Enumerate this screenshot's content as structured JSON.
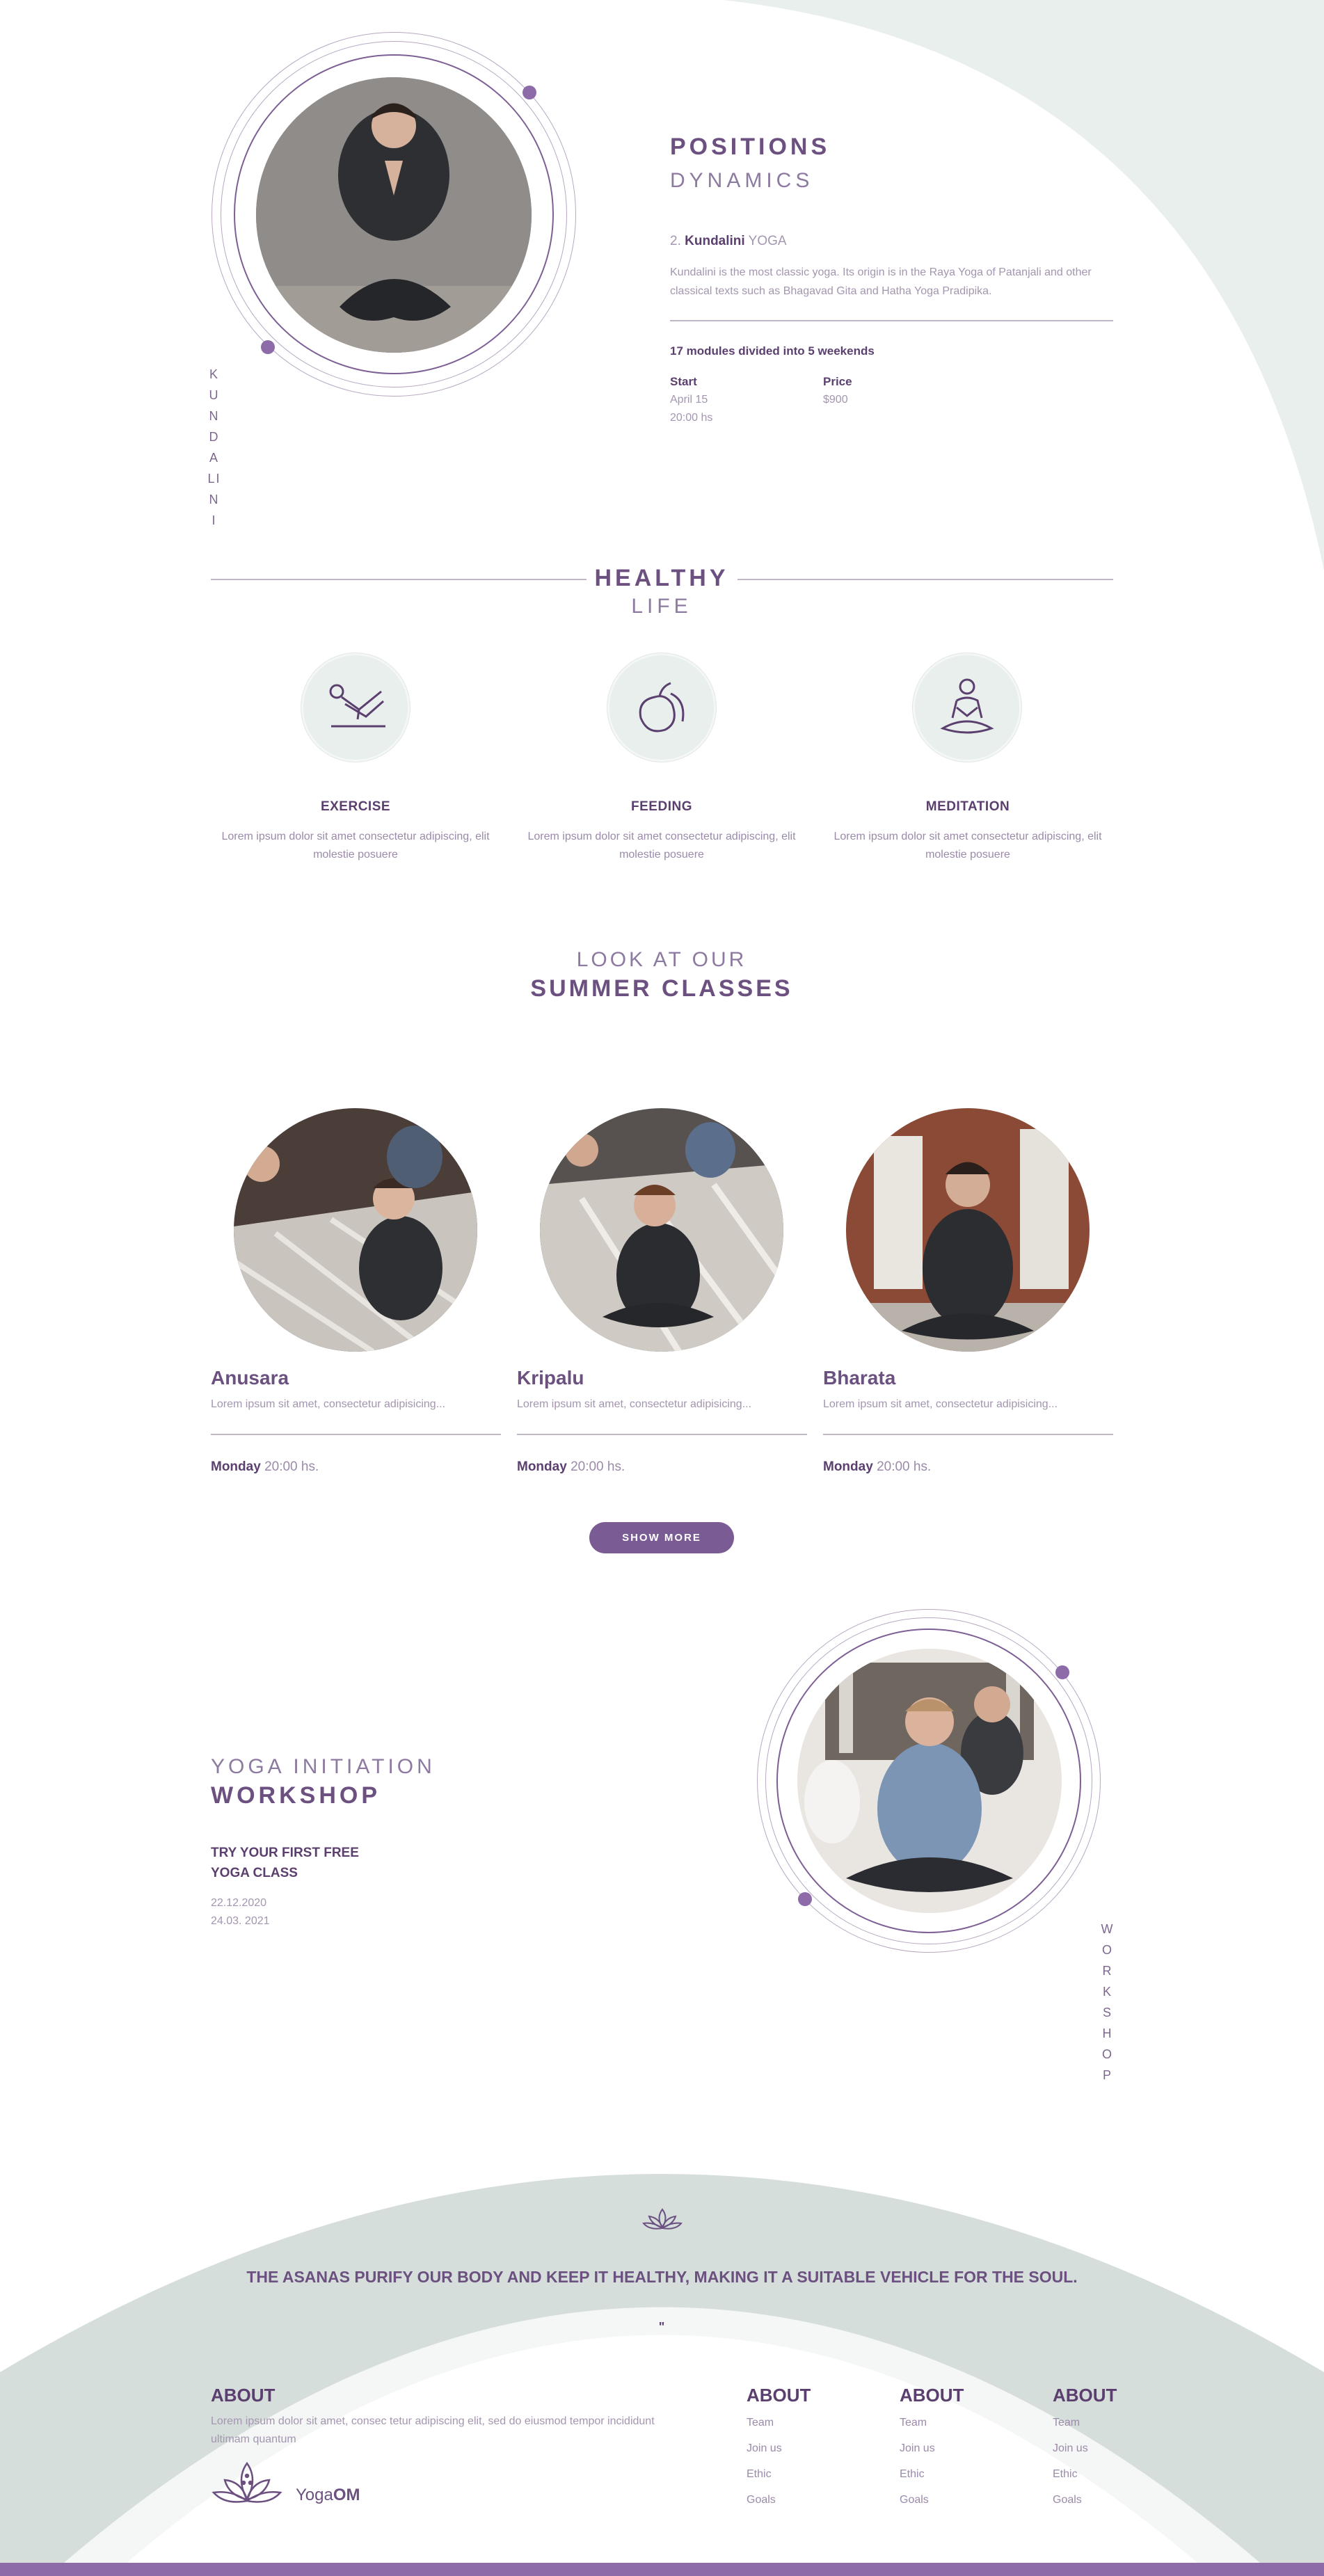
{
  "colors": {
    "accent": "#6b5080",
    "accent_light": "#8d6ba8",
    "mint": "#e8efec",
    "footer_bar": "#8d6ba8"
  },
  "hero": {
    "vertical_word": [
      "K",
      "U",
      "N",
      "D",
      "A",
      "LI",
      "N",
      "I"
    ],
    "title": "POSITIONS",
    "subtitle": "DYNAMICS",
    "number": "2.",
    "yoga_name": "Kundalini",
    "yoga_suffix": "YOGA",
    "description": "Kundalini is the most classic yoga. Its origin is in the Raya Yoga of Patanjali and other classical texts such as Bhagavad Gita and Hatha Yoga Pradipika.",
    "modules": "17 modules divided into 5 weekends",
    "start_label": "Start",
    "start_date": "April 15",
    "start_time": "20:00 hs",
    "price_label": "Price",
    "price_value": "$900"
  },
  "healthy": {
    "title": "HEALTHY",
    "subtitle": "LIFE",
    "features": [
      {
        "icon": "exercise-icon",
        "title": "EXERCISE",
        "text": "Lorem ipsum dolor sit amet consectetur adipiscing, elit molestie posuere"
      },
      {
        "icon": "feeding-icon",
        "title": "FEEDING",
        "text": "Lorem ipsum dolor sit amet consectetur adipiscing, elit molestie posuere"
      },
      {
        "icon": "meditation-icon",
        "title": "MEDITATION",
        "text": "Lorem ipsum dolor sit amet consectetur adipiscing, elit molestie posuere"
      }
    ]
  },
  "summer": {
    "pre_title": "LOOK AT OUR",
    "title": "SUMMER CLASSES",
    "classes": [
      {
        "name": "Anusara",
        "desc": "Lorem ipsum sit amet, consectetur adipisicing...",
        "day": "Monday",
        "time": "20:00 hs."
      },
      {
        "name": "Kripalu",
        "desc": "Lorem ipsum sit amet, consectetur adipisicing...",
        "day": "Monday",
        "time": "20:00 hs."
      },
      {
        "name": "Bharata",
        "desc": "Lorem ipsum sit amet, consectetur adipisicing...",
        "day": "Monday",
        "time": "20:00 hs."
      }
    ],
    "show_more": "SHOW MORE"
  },
  "workshop": {
    "pre_title": "YOGA INITIATION",
    "title": "WORKSHOP",
    "cta_line1": "TRY YOUR FIRST FREE",
    "cta_line2": "YOGA CLASS",
    "date1": "22.12.2020",
    "date2": "24.03. 2021",
    "vertical_word": [
      "W",
      "O",
      "R",
      "K",
      "S",
      "H",
      "O",
      "P"
    ]
  },
  "quote": {
    "text": "THE ASANAS PURIFY OUR BODY AND KEEP IT HEALTHY, MAKING IT A SUITABLE VEHICLE FOR THE SOUL.",
    "mark": "\""
  },
  "footer": {
    "about_title": "ABOUT",
    "about_text": "Lorem ipsum dolor sit amet, consec tetur adipiscing elit, sed do eiusmod tempor incididunt ultimam quantum",
    "logo_text": "Yoga",
    "logo_bold": "OM",
    "columns": [
      {
        "title": "ABOUT",
        "links": [
          "Team",
          "Join us",
          "Ethic",
          "Goals"
        ]
      },
      {
        "title": "ABOUT",
        "links": [
          "Team",
          "Join us",
          "Ethic",
          "Goals"
        ]
      },
      {
        "title": "ABOUT",
        "links": [
          "Team",
          "Join us",
          "Ethic",
          "Goals"
        ]
      }
    ]
  }
}
